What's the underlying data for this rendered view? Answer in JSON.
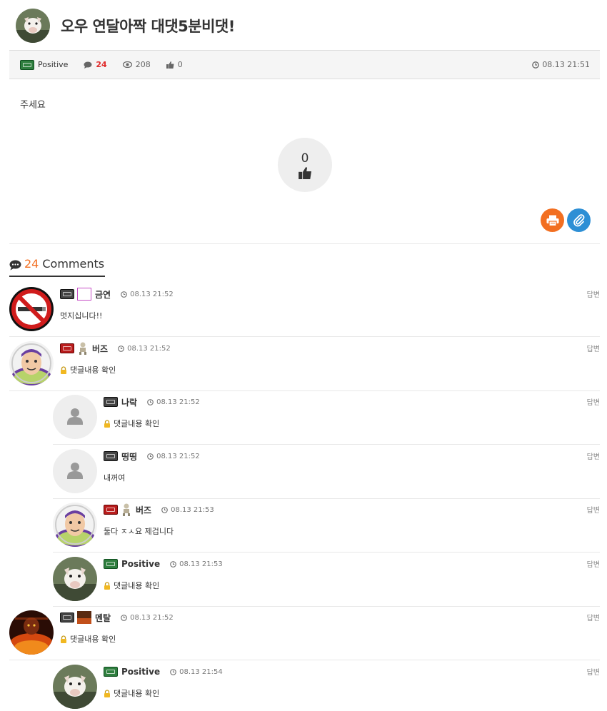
{
  "post": {
    "title": "오우 연달아짝 대댓5분비댓!",
    "author": "Positive",
    "comment_count": "24",
    "views": "208",
    "likes": "0",
    "date": "08.13 21:51",
    "body": "주세요",
    "like_count": "0"
  },
  "comments_header": {
    "count": "24",
    "label": "Comments"
  },
  "comments": [
    {
      "nick": "금연",
      "time": "08.13 21:52",
      "text": "멋지십니다!!",
      "secret": false,
      "reply": "답변",
      "level": "gray",
      "avatar": "no-smoking"
    },
    {
      "nick": "버즈",
      "time": "08.13 21:52",
      "text": "댓글내용 확인",
      "secret": true,
      "reply": "답변",
      "level": "red",
      "avatar": "buzz"
    },
    {
      "nick": "나락",
      "time": "08.13 21:52",
      "text": "댓글내용 확인",
      "secret": true,
      "reply": "답변",
      "level": "gray",
      "avatar": "default"
    },
    {
      "nick": "띵띵",
      "time": "08.13 21:52",
      "text": "내꺼여",
      "secret": false,
      "reply": "답변",
      "level": "gray",
      "avatar": "default"
    },
    {
      "nick": "버즈",
      "time": "08.13 21:53",
      "text": "둘다 ㅈㅅ요 제겁니다",
      "secret": false,
      "reply": "답변",
      "level": "red",
      "avatar": "buzz"
    },
    {
      "nick": "Positive",
      "time": "08.13 21:53",
      "text": "댓글내용 확인",
      "secret": true,
      "reply": "답변",
      "level": "green",
      "avatar": "pig"
    },
    {
      "nick": "멘탈",
      "time": "08.13 21:52",
      "text": "댓글내용 확인",
      "secret": true,
      "reply": "답변",
      "level": "gray",
      "avatar": "fire"
    },
    {
      "nick": "Positive",
      "time": "08.13 21:54",
      "text": "댓글내용 확인",
      "secret": true,
      "reply": "답변",
      "level": "green",
      "avatar": "pig"
    }
  ]
}
